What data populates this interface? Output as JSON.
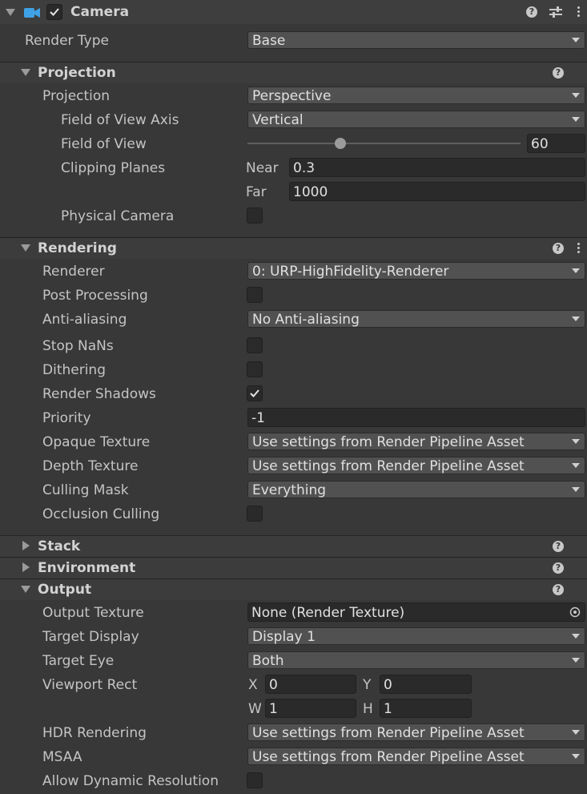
{
  "header": {
    "title": "Camera",
    "enabled": true,
    "icon": "camera-icon"
  },
  "render_type": {
    "label": "Render Type",
    "value": "Base"
  },
  "projection": {
    "title": "Projection",
    "projection_label": "Projection",
    "projection_value": "Perspective",
    "fov_axis_label": "Field of View Axis",
    "fov_axis_value": "Vertical",
    "fov_label": "Field of View",
    "fov_value": "60",
    "fov_slider_fraction": 0.34,
    "clipping_label": "Clipping Planes",
    "near_label": "Near",
    "near_value": "0.3",
    "far_label": "Far",
    "far_value": "1000",
    "physical_label": "Physical Camera",
    "physical_checked": false
  },
  "rendering": {
    "title": "Rendering",
    "renderer_label": "Renderer",
    "renderer_value": "0: URP-HighFidelity-Renderer",
    "post_label": "Post Processing",
    "aa_label": "Anti-aliasing",
    "aa_value": "No Anti-aliasing",
    "nans_label": "Stop NaNs",
    "dither_label": "Dithering",
    "shadows_label": "Render Shadows",
    "priority_label": "Priority",
    "priority_value": "-1",
    "opaque_label": "Opaque Texture",
    "opaque_value": "Use settings from Render Pipeline Asset",
    "depth_label": "Depth Texture",
    "depth_value": "Use settings from Render Pipeline Asset",
    "culling_label": "Culling Mask",
    "culling_value": "Everything",
    "occlusion_label": "Occlusion Culling"
  },
  "stack": {
    "title": "Stack"
  },
  "environment": {
    "title": "Environment"
  },
  "output": {
    "title": "Output",
    "texture_label": "Output Texture",
    "texture_value": "None (Render Texture)",
    "display_label": "Target Display",
    "display_value": "Display 1",
    "eye_label": "Target Eye",
    "eye_value": "Both",
    "viewport_label": "Viewport Rect",
    "x_label": "X",
    "x_value": "0",
    "y_label": "Y",
    "y_value": "0",
    "w_label": "W",
    "w_value": "1",
    "h_label": "H",
    "h_value": "1",
    "hdr_label": "HDR Rendering",
    "hdr_value": "Use settings from Render Pipeline Asset",
    "msaa_label": "MSAA",
    "msaa_value": "Use settings from Render Pipeline Asset",
    "dynres_label": "Allow Dynamic Resolution"
  },
  "colors": {
    "background": "#383838",
    "header": "#3e3e3e",
    "field": "#2a2a2a",
    "dropdown": "#515151",
    "camera_icon": "#3fa2e6"
  }
}
